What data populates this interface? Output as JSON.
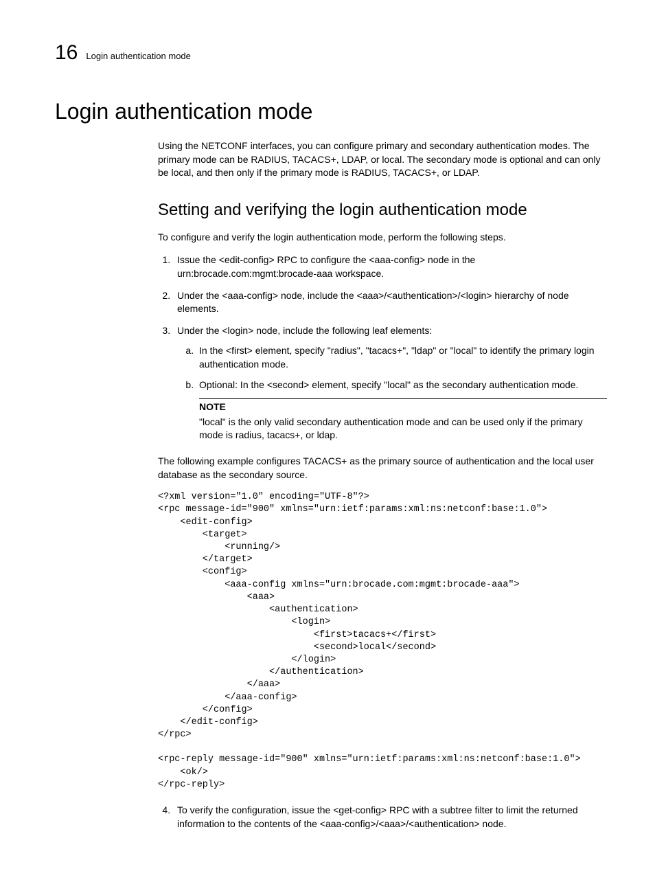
{
  "header": {
    "chapter_number": "16",
    "running_title": "Login authentication mode"
  },
  "title": "Login authentication mode",
  "intro": "Using the NETCONF interfaces, you can configure primary and secondary authentication modes. The primary mode can be RADIUS, TACACS+, LDAP, or local. The secondary mode is optional and can only be local, and then only if the primary mode is RADIUS, TACACS+, or LDAP.",
  "subhead": "Setting and verifying the login authentication mode",
  "lead": "To configure and verify the login authentication mode, perform the following steps.",
  "steps": {
    "s1": "Issue the <edit-config> RPC to configure the <aaa-config> node in the urn:brocade.com:mgmt:brocade-aaa workspace.",
    "s2": "Under the <aaa-config> node, include the <aaa>/<authentication>/<login> hierarchy of node elements.",
    "s3": "Under the <login> node, include the following leaf elements:",
    "s3a": "In the <first> element, specify \"radius\", \"tacacs+\", \"ldap\" or \"local\" to identify the primary login authentication mode.",
    "s3b": "Optional: In the <second> element, specify \"local\" as the secondary authentication mode.",
    "note_label": "NOTE",
    "note_text": "\"local\" is the only valid secondary authentication mode and can be used only if the primary mode is radius, tacacs+, or ldap.",
    "s4": "To verify the configuration, issue the <get-config> RPC with a subtree filter to limit the returned information to the contents of the <aaa-config>/<aaa>/<authentication> node."
  },
  "example_lead": "The following example configures TACACS+ as the primary source of authentication and the local user database as the secondary source.",
  "code1": "<?xml version=\"1.0\" encoding=\"UTF-8\"?>\n<rpc message-id=\"900\" xmlns=\"urn:ietf:params:xml:ns:netconf:base:1.0\">\n    <edit-config>\n        <target>\n            <running/>\n        </target>\n        <config>\n            <aaa-config xmlns=\"urn:brocade.com:mgmt:brocade-aaa\">\n                <aaa>\n                    <authentication>\n                        <login>\n                            <first>tacacs+</first>\n                            <second>local</second>\n                        </login>\n                    </authentication>\n                </aaa>\n            </aaa-config>\n        </config>\n    </edit-config>\n</rpc>",
  "code2": "<rpc-reply message-id=\"900\" xmlns=\"urn:ietf:params:xml:ns:netconf:base:1.0\">\n    <ok/>\n</rpc-reply>"
}
